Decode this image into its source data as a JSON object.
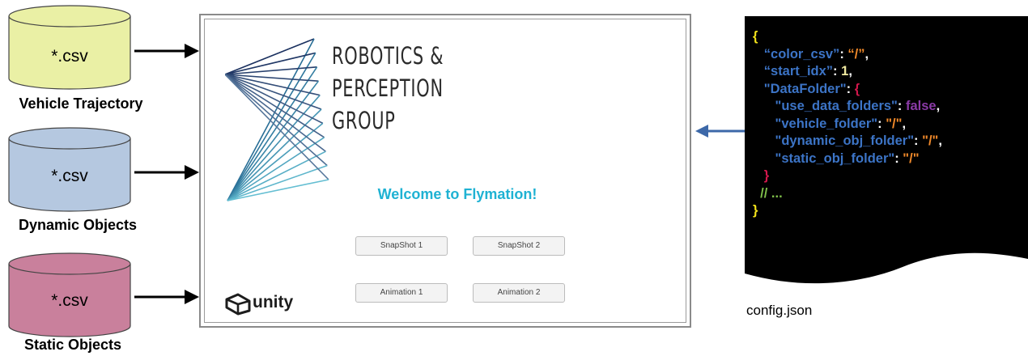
{
  "inputs": [
    {
      "file_label": "*.csv",
      "caption": "Vehicle Trajectory",
      "color": "#eaf0a5"
    },
    {
      "file_label": "*.csv",
      "caption": "Dynamic Objects",
      "color": "#b5c8e0"
    },
    {
      "file_label": "*.csv",
      "caption": "Static Objects",
      "color": "#c9809c"
    }
  ],
  "app_window": {
    "logo_lines": [
      "ROBOTICS &",
      "PERCEPTION",
      "GROUP"
    ],
    "welcome": "Welcome to Flymation!",
    "buttons": {
      "snapshot1": "SnapShot 1",
      "snapshot2": "SnapShot 2",
      "animation1": "Animation 1",
      "animation2": "Animation 2"
    },
    "engine_logo_text": "unity",
    "engine_icon": "unity-cube-icon"
  },
  "config": {
    "caption": "config.json",
    "lines": [
      {
        "indent": "",
        "parts": [
          {
            "t": "{",
            "c": "c-brace"
          }
        ]
      },
      {
        "indent": "   ",
        "parts": [
          {
            "t": "“color_csv”",
            "c": "c-key"
          },
          {
            "t": ": ",
            "c": "c-punct"
          },
          {
            "t": "“/”",
            "c": "c-str"
          },
          {
            "t": ",",
            "c": "c-punct"
          }
        ]
      },
      {
        "indent": "   ",
        "parts": [
          {
            "t": "“start_idx”",
            "c": "c-key"
          },
          {
            "t": ": ",
            "c": "c-punct"
          },
          {
            "t": "1",
            "c": "c-num"
          },
          {
            "t": ",",
            "c": "c-punct"
          }
        ]
      },
      {
        "indent": "   ",
        "parts": [
          {
            "t": "\"DataFolder\"",
            "c": "c-key"
          },
          {
            "t": ": ",
            "c": "c-punct"
          },
          {
            "t": "{",
            "c": "c-inner"
          }
        ]
      },
      {
        "indent": "      ",
        "parts": [
          {
            "t": "\"use_data_folders\"",
            "c": "c-key"
          },
          {
            "t": ": ",
            "c": "c-punct"
          },
          {
            "t": "false",
            "c": "c-bool"
          },
          {
            "t": ",",
            "c": "c-punct"
          }
        ]
      },
      {
        "indent": "      ",
        "parts": [
          {
            "t": "\"vehicle_folder\"",
            "c": "c-key"
          },
          {
            "t": ": ",
            "c": "c-punct"
          },
          {
            "t": "\"/\"",
            "c": "c-str"
          },
          {
            "t": ",",
            "c": "c-punct"
          }
        ]
      },
      {
        "indent": "      ",
        "parts": [
          {
            "t": "\"dynamic_obj_folder\"",
            "c": "c-key"
          },
          {
            "t": ": ",
            "c": "c-punct"
          },
          {
            "t": "\"/\"",
            "c": "c-str"
          },
          {
            "t": ",",
            "c": "c-punct"
          }
        ]
      },
      {
        "indent": "      ",
        "parts": [
          {
            "t": "\"static_obj_folder\"",
            "c": "c-key"
          },
          {
            "t": ": ",
            "c": "c-punct"
          },
          {
            "t": "\"/\"",
            "c": "c-str"
          }
        ]
      },
      {
        "indent": "   ",
        "parts": [
          {
            "t": "}",
            "c": "c-inner"
          }
        ]
      },
      {
        "indent": "  ",
        "parts": [
          {
            "t": "// ...",
            "c": "c-comment"
          }
        ]
      },
      {
        "indent": "",
        "parts": [
          {
            "t": "}",
            "c": "c-brace"
          }
        ]
      }
    ]
  }
}
